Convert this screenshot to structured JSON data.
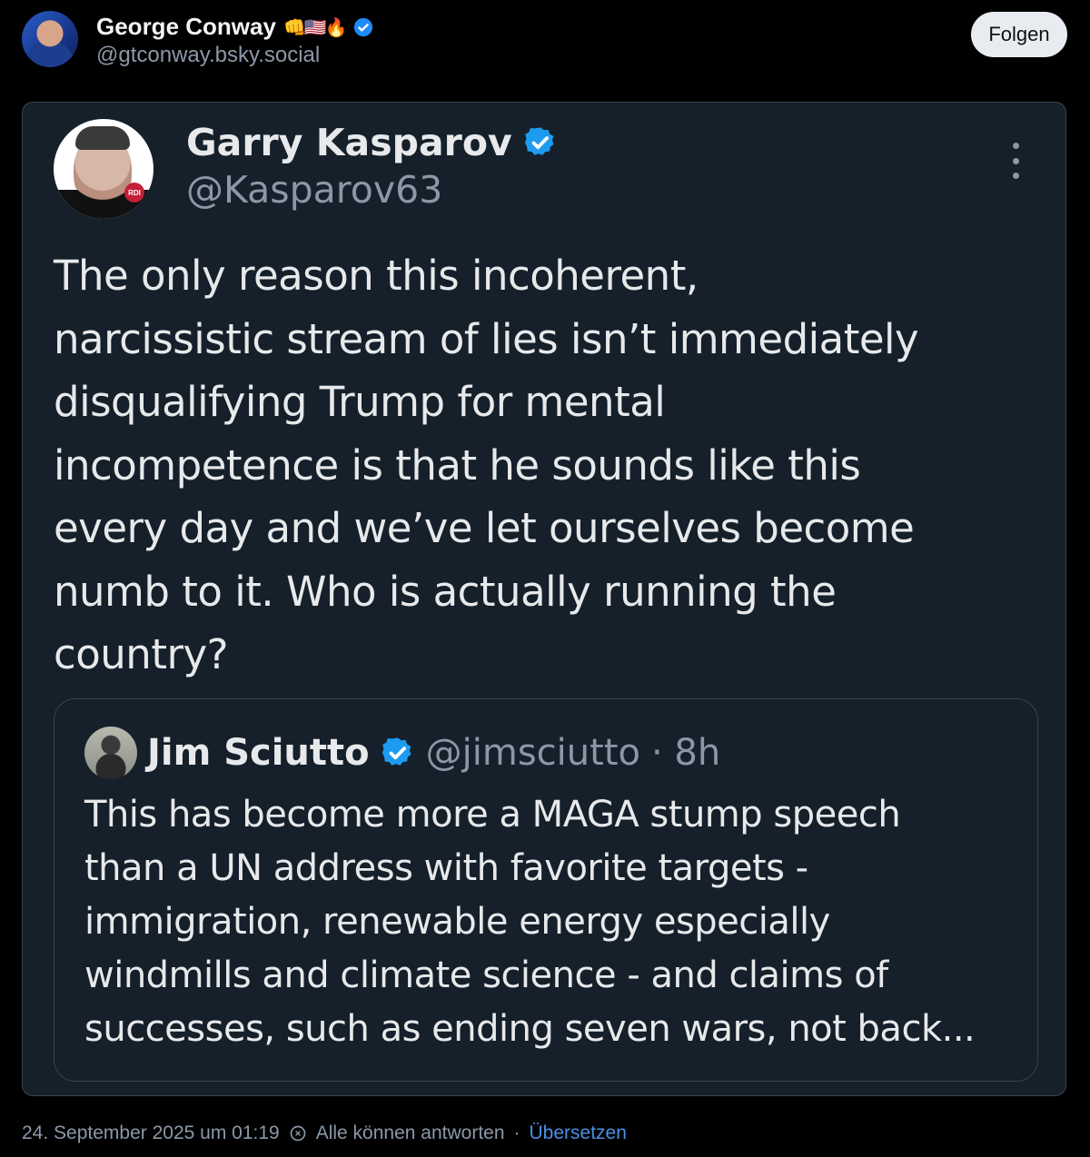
{
  "post": {
    "author_name": "George Conway",
    "author_emojis": "👊🇺🇸🔥",
    "author_handle": "@gtconway.bsky.social",
    "follow_label": "Folgen",
    "timestamp": "24. September 2025 um 01:19",
    "reply_setting": "Alle können antworten",
    "separator": "·",
    "translate_label": "Übersetzen"
  },
  "screenshot": {
    "author_name": "Garry Kasparov",
    "author_handle": "@Kasparov63",
    "avatar_badge": "RDI",
    "text": "The only reason this incoherent,\nnarcissistic stream of lies isn’t immediately\ndisqualifying Trump for mental\nincompetence is that he sounds like this\nevery day and we’ve let ourselves become\nnumb to it. Who is actually running the\ncountry?",
    "quote": {
      "author_name": "Jim Sciutto",
      "author_handle": "@jimsciutto",
      "time": "· 8h",
      "text": "This has become more a MAGA stump speech\nthan a UN address with favorite targets -\nimmigration, renewable energy especially\nwindmills and climate science - and claims of\nsuccesses, such as ending seven wars, not back..."
    }
  },
  "colors": {
    "background": "#000000",
    "card_bg": "#15202b",
    "verified_blue": "#1d9bf0",
    "link_blue": "#4c8ee6"
  }
}
